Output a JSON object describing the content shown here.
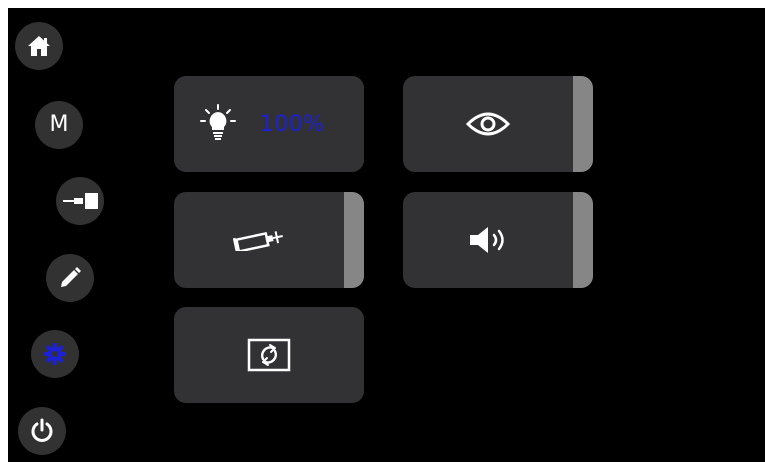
{
  "nav": {
    "items": [
      {
        "id": "home",
        "icon": "home-icon"
      },
      {
        "id": "mode",
        "label": "M"
      },
      {
        "id": "syringe",
        "icon": "syringe-plug-icon"
      },
      {
        "id": "edit",
        "icon": "pencil-icon"
      },
      {
        "id": "settings",
        "icon": "gear-icon",
        "active": true
      },
      {
        "id": "power",
        "icon": "power-icon"
      }
    ]
  },
  "tiles": {
    "brightness": {
      "icon": "lightbulb-icon",
      "value": "100%"
    },
    "visibility": {
      "icon": "eye-icon"
    },
    "syringe": {
      "icon": "syringe-icon"
    },
    "sound": {
      "icon": "speaker-icon"
    },
    "rotate": {
      "icon": "rotate-screen-icon"
    }
  },
  "colors": {
    "background": "#000000",
    "button": "#323232",
    "tile": "#323234",
    "tile_edge": "#868686",
    "accent": "#1c20d6",
    "icon": "#ffffff"
  }
}
